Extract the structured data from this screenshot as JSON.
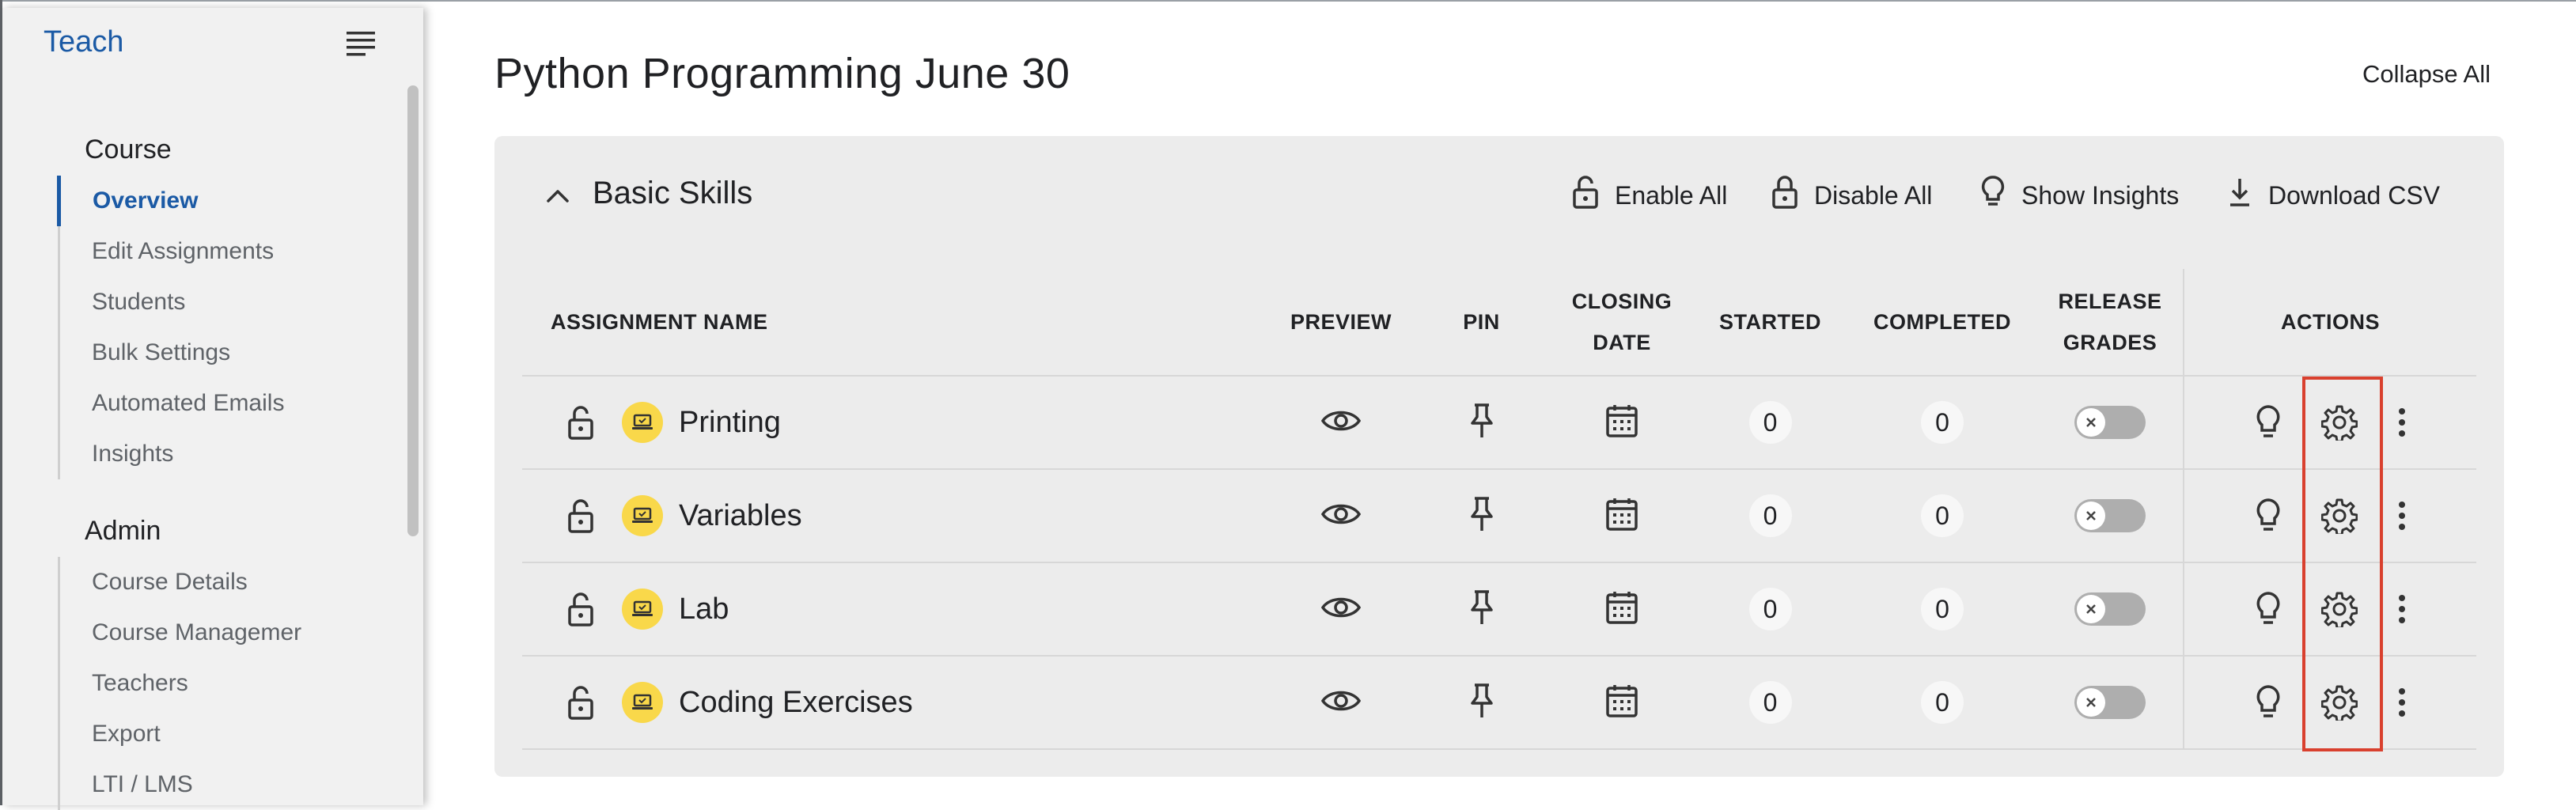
{
  "sidebar": {
    "brand": "Teach",
    "course_section": {
      "title": "Course",
      "items": [
        {
          "label": "Overview",
          "active": true
        },
        {
          "label": "Edit Assignments"
        },
        {
          "label": "Students"
        },
        {
          "label": "Bulk Settings"
        },
        {
          "label": "Automated Emails"
        },
        {
          "label": "Insights"
        }
      ]
    },
    "admin_section": {
      "title": "Admin",
      "items": [
        {
          "label": "Course Details"
        },
        {
          "label": "Course Managemer"
        },
        {
          "label": "Teachers"
        },
        {
          "label": "Export"
        },
        {
          "label": "LTI / LMS"
        }
      ]
    }
  },
  "header": {
    "title": "Python Programming June 30",
    "collapse_all": "Collapse All"
  },
  "section": {
    "title": "Basic Skills",
    "toolbar": {
      "enable_all": "Enable All",
      "disable_all": "Disable All",
      "show_insights": "Show Insights",
      "download_csv": "Download CSV"
    },
    "table": {
      "headers": {
        "name": "ASSIGNMENT NAME",
        "preview": "PREVIEW",
        "pin": "PIN",
        "closing_date": [
          "CLOSING",
          "DATE"
        ],
        "started": "STARTED",
        "completed": "COMPLETED",
        "release_grades": [
          "RELEASE",
          "GRADES"
        ],
        "actions": "ACTIONS"
      },
      "rows": [
        {
          "name": "Printing",
          "started": "0",
          "completed": "0",
          "release_grades": false
        },
        {
          "name": "Variables",
          "started": "0",
          "completed": "0",
          "release_grades": false
        },
        {
          "name": "Lab",
          "started": "0",
          "completed": "0",
          "release_grades": false
        },
        {
          "name": "Coding Exercises",
          "started": "0",
          "completed": "0",
          "release_grades": false
        }
      ]
    }
  },
  "colors": {
    "accent": "#1b5aa5",
    "badge": "#f9d84a",
    "highlight": "#d9402e",
    "panel": "#ececec"
  },
  "icons": [
    "menu-icon",
    "chevron-up-icon",
    "lock-open-icon",
    "lightbulb-icon",
    "download-icon",
    "laptop-icon",
    "eye-icon",
    "pin-icon",
    "calendar-icon",
    "close-icon",
    "gear-icon",
    "more-vertical-icon"
  ]
}
